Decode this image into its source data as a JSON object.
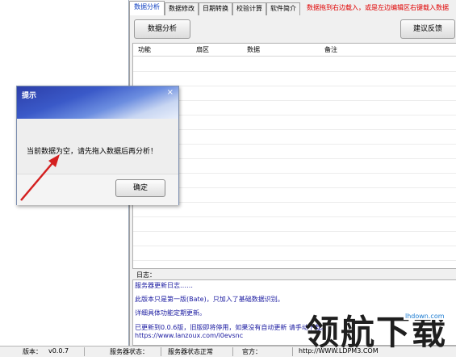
{
  "tabs": [
    {
      "label": "数据分析",
      "active": true
    },
    {
      "label": "数据修改",
      "active": false
    },
    {
      "label": "日期转换",
      "active": false
    },
    {
      "label": "校验计算",
      "active": false
    },
    {
      "label": "软件简介",
      "active": false
    }
  ],
  "drop_hint": "数据拖到右边载入，或是左边编辑区右键载入数据",
  "toolbar": {
    "analyze_label": "数据分析",
    "feedback_label": "建议反馈"
  },
  "grid": {
    "columns": [
      "功能",
      "扇区",
      "数据",
      "备注"
    ]
  },
  "log": {
    "label": "日志：",
    "lines": [
      "服务器更新日志……",
      "此版本只是第一版(Bate)，只加入了基础数据识别。",
      "详细具体功能定期更新。",
      "已更新到0.0.6版，旧版即将停用，如果没有自动更新 请手动下载。",
      "https://www.lanzoux.com/i0evsnc"
    ]
  },
  "status": {
    "version_label": "版本：",
    "version_value": "v0.0.7",
    "server_label": "服务器状态：",
    "server_value": "服务器状态正常",
    "official_label": "官方：",
    "official_value": "http://WWW.LDPM3.COM"
  },
  "dialog": {
    "title": "提示",
    "close_glyph": "×",
    "message": "当前数据为空，请先拖入数据后再分析！",
    "ok_label": "确定"
  },
  "watermark": {
    "text": "领航下载",
    "url": "lhdown.com"
  },
  "colors": {
    "tab_active_text": "#1040c0",
    "hint_red": "#e00000",
    "log_blue": "#1a1aa0",
    "arrow_red": "#d42020",
    "dialog_title_blue": "#3a59c8"
  }
}
